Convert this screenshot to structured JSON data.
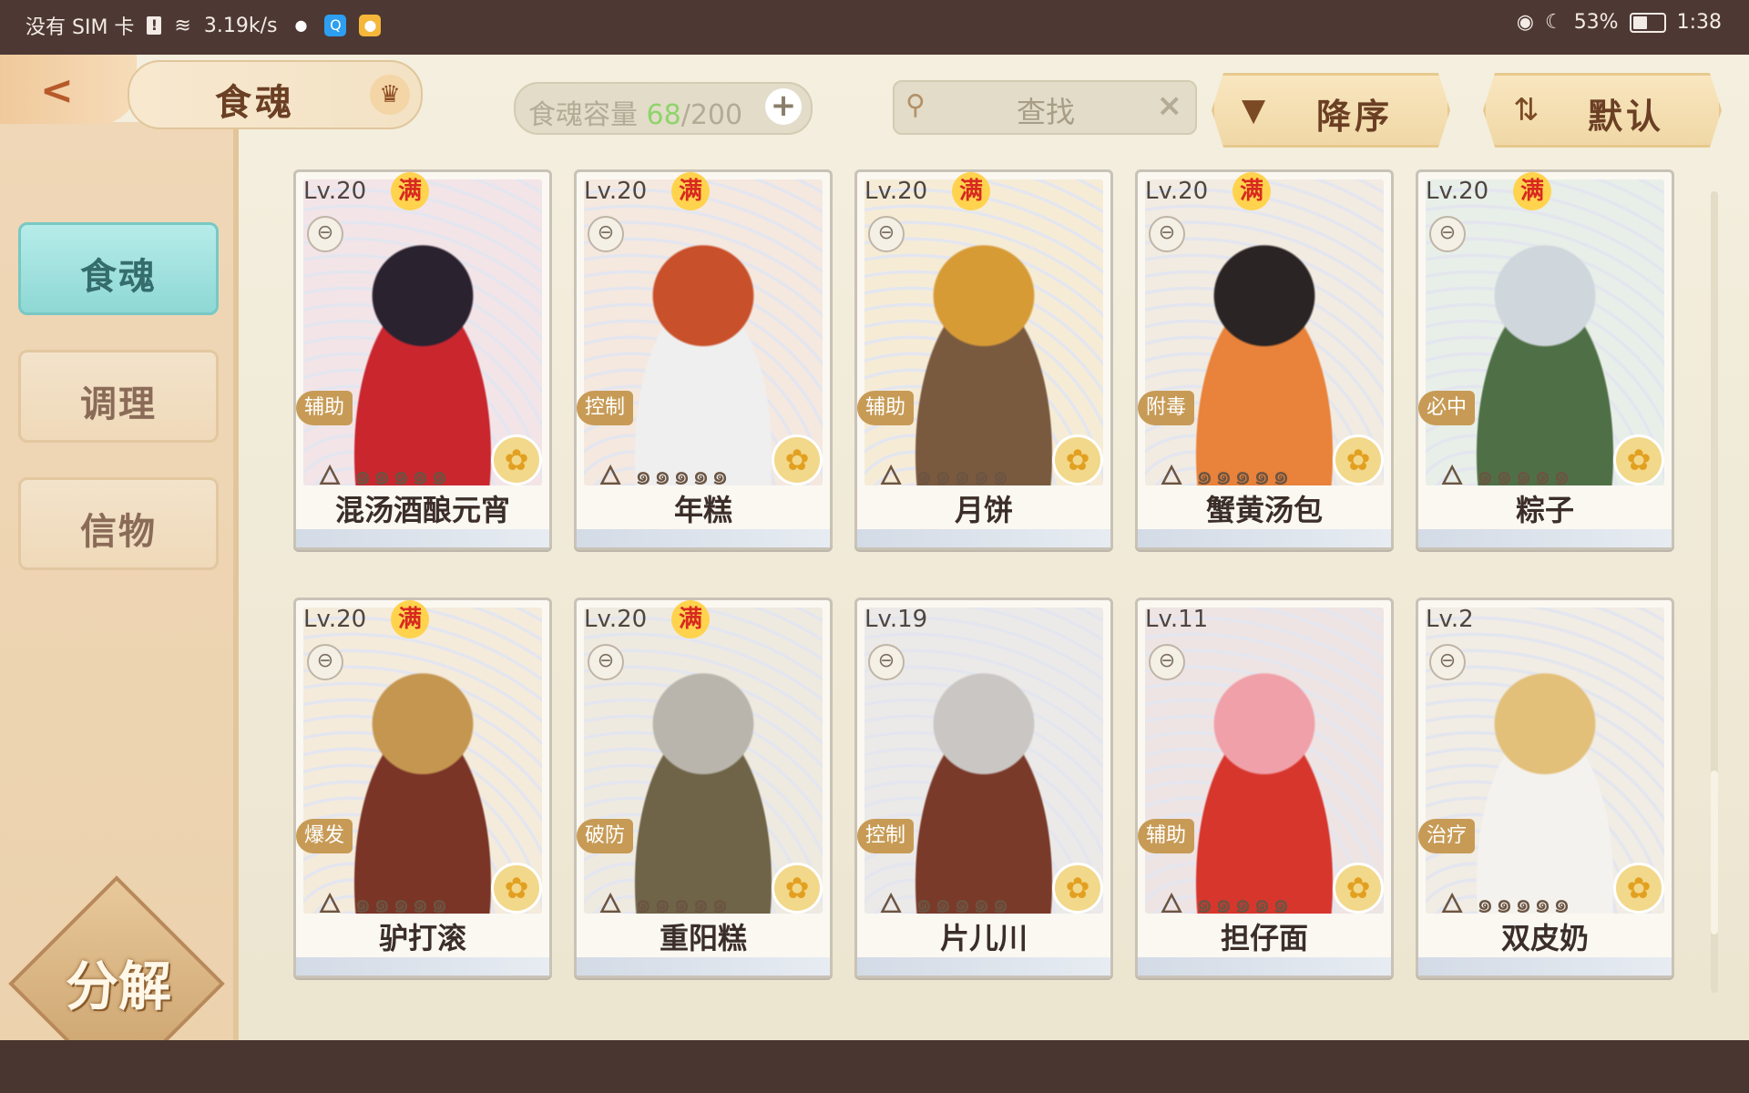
{
  "status_bar": {
    "carrier": "没有 SIM 卡",
    "speed": "3.19k/s",
    "battery": "53%",
    "battery_level": 0.53,
    "time": "1:38"
  },
  "header": {
    "title": "食魂",
    "capacity_label": "食魂容量",
    "capacity_current": "68",
    "capacity_max": "/200",
    "search_placeholder": "查找",
    "sort_order": "降序",
    "sort_default": "默认"
  },
  "sidebar": {
    "tabs": [
      {
        "label": "食魂",
        "active": true
      },
      {
        "label": "调理",
        "active": false
      },
      {
        "label": "信物",
        "active": false
      }
    ],
    "decompose_label": "分解"
  },
  "cards": [
    {
      "level": "Lv.20",
      "max": "满",
      "role": "辅助",
      "name": "混汤酒酿元宵",
      "colors": [
        "#f3e4e8",
        "#2b2230",
        "#c9262e"
      ]
    },
    {
      "level": "Lv.20",
      "max": "满",
      "role": "控制",
      "name": "年糕",
      "colors": [
        "#f5e8df",
        "#c8502a",
        "#efefef"
      ]
    },
    {
      "level": "Lv.20",
      "max": "满",
      "role": "辅助",
      "name": "月饼",
      "colors": [
        "#f6ecd6",
        "#d79b36",
        "#7a5a3f"
      ]
    },
    {
      "level": "Lv.20",
      "max": "满",
      "role": "附毒",
      "name": "蟹黄汤包",
      "colors": [
        "#f2ebe1",
        "#2a2424",
        "#e9823a"
      ]
    },
    {
      "level": "Lv.20",
      "max": "满",
      "role": "必中",
      "name": "粽子",
      "colors": [
        "#e8efe8",
        "#cfd6dc",
        "#4f7046"
      ]
    },
    {
      "level": "Lv.20",
      "max": "满",
      "role": "爆发",
      "name": "驴打滚",
      "colors": [
        "#f5ebdb",
        "#c49650",
        "#7a3526"
      ]
    },
    {
      "level": "Lv.20",
      "max": "满",
      "role": "破防",
      "name": "重阳糕",
      "colors": [
        "#efeae0",
        "#b9b5ac",
        "#6f6448"
      ]
    },
    {
      "level": "Lv.19",
      "max": "",
      "role": "控制",
      "name": "片儿川",
      "colors": [
        "#eceae8",
        "#c9c6c4",
        "#7a3a2a"
      ]
    },
    {
      "level": "Lv.11",
      "max": "",
      "role": "辅助",
      "name": "担仔面",
      "colors": [
        "#efe4e4",
        "#f0a0a8",
        "#d7362d"
      ]
    },
    {
      "level": "Lv.2",
      "max": "",
      "role": "治疗",
      "name": "双皮奶",
      "colors": [
        "#f1ece4",
        "#e2c07a",
        "#f4f2ee"
      ]
    }
  ]
}
